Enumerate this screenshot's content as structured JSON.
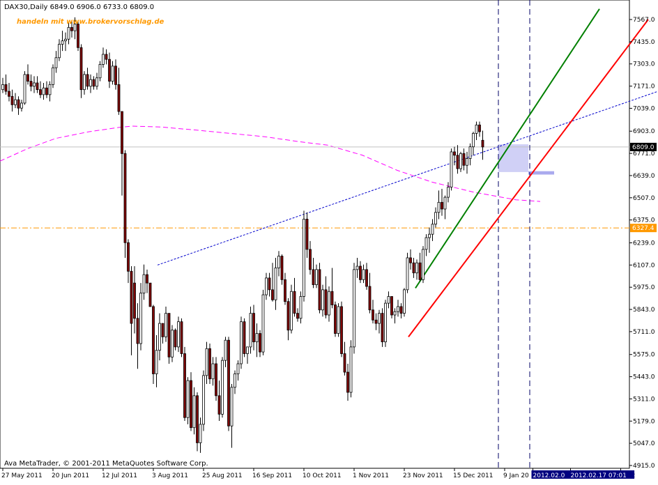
{
  "header": {
    "symbol_info": "DAX30,Daily  6849.0 6906.0 6733.0 6809.0",
    "watermark": "handeln mit www.brokervorschlag.de"
  },
  "footer": {
    "copyright": "Ava MetaTrader, © 2001-2011 MetaQuotes Software Corp."
  },
  "colors": {
    "background": "#ffffff",
    "frame": "#000000",
    "bull_candle": "#ffffff",
    "bear_candle": "#800000",
    "moving_average": "#ff00ff",
    "trendline_dashed": "#0000cc",
    "upper_channel": "#008000",
    "lower_channel": "#ff0000",
    "horizontal_level": "#ff9900",
    "watermark": "#ff9900",
    "highlight_zone": "#aaaaee",
    "current_price_label": "#000000"
  },
  "chart_data": {
    "type": "candlestick",
    "title": "DAX30,Daily",
    "last_bar": {
      "open": 6849.0,
      "high": 6906.0,
      "low": 6733.0,
      "close": 6809.0
    },
    "ylim": [
      4915,
      7630
    ],
    "y_ticks": [
      "7567.0",
      "7435.0",
      "7303.0",
      "7171.0",
      "7039.0",
      "6903.0",
      "6771.0",
      "6639.0",
      "6507.0",
      "6375.0",
      "6239.0",
      "6107.0",
      "5975.0",
      "5843.0",
      "5711.0",
      "5575.0",
      "5443.0",
      "5311.0",
      "5179.0",
      "5047.0",
      "4915.0"
    ],
    "y_tick_values": [
      7567,
      7435,
      7303,
      7171,
      7039,
      6903,
      6771,
      6639,
      6507,
      6375,
      6239,
      6107,
      5975,
      5843,
      5711,
      5575,
      5443,
      5311,
      5179,
      5047,
      4915
    ],
    "x_ticks": [
      "27 May 2011",
      "20 Jun 2011",
      "12 Jul 2011",
      "3 Aug 2011",
      "25 Aug 2011",
      "16 Sep 2011",
      "10 Oct 2011",
      "1 Nov 2011",
      "23 Nov 2011",
      "15 Dec 2011",
      "9 Jan 20",
      "2012",
      "2012.02.0",
      "2012.02.17 07:01"
    ],
    "x_tick_bars": [
      0,
      16,
      32,
      48,
      64,
      80,
      96,
      112,
      128,
      144,
      160,
      197,
      169,
      181
    ],
    "x_tick_highlighted": [
      false,
      false,
      false,
      false,
      false,
      false,
      false,
      false,
      false,
      false,
      false,
      false,
      true,
      true
    ],
    "current_price_label": "6809.0",
    "level_label": "6327.4",
    "horizontal_level": 6327.4,
    "price_marker": 6809.0,
    "bars": [
      [
        7150,
        7220,
        7130,
        7180
      ],
      [
        7180,
        7240,
        7120,
        7140
      ],
      [
        7140,
        7190,
        7080,
        7110
      ],
      [
        7110,
        7150,
        7020,
        7060
      ],
      [
        7060,
        7130,
        7040,
        7090
      ],
      [
        7090,
        7110,
        7000,
        7040
      ],
      [
        7040,
        7090,
        7020,
        7070
      ],
      [
        7070,
        7260,
        7060,
        7240
      ],
      [
        7240,
        7300,
        7180,
        7200
      ],
      [
        7200,
        7240,
        7140,
        7170
      ],
      [
        7170,
        7230,
        7130,
        7190
      ],
      [
        7190,
        7230,
        7130,
        7150
      ],
      [
        7150,
        7200,
        7100,
        7120
      ],
      [
        7120,
        7190,
        7090,
        7160
      ],
      [
        7160,
        7200,
        7100,
        7120
      ],
      [
        7120,
        7200,
        7080,
        7180
      ],
      [
        7180,
        7300,
        7160,
        7280
      ],
      [
        7280,
        7380,
        7250,
        7340
      ],
      [
        7340,
        7450,
        7320,
        7420
      ],
      [
        7420,
        7500,
        7380,
        7440
      ],
      [
        7440,
        7490,
        7380,
        7450
      ],
      [
        7450,
        7550,
        7420,
        7520
      ],
      [
        7520,
        7560,
        7460,
        7500
      ],
      [
        7500,
        7580,
        7450,
        7540
      ],
      [
        7540,
        7560,
        7380,
        7400
      ],
      [
        7400,
        7420,
        7100,
        7150
      ],
      [
        7150,
        7260,
        7120,
        7240
      ],
      [
        7240,
        7280,
        7150,
        7170
      ],
      [
        7170,
        7240,
        7130,
        7210
      ],
      [
        7210,
        7230,
        7150,
        7170
      ],
      [
        7170,
        7250,
        7150,
        7220
      ],
      [
        7220,
        7320,
        7200,
        7300
      ],
      [
        7300,
        7400,
        7280,
        7360
      ],
      [
        7360,
        7390,
        7300,
        7330
      ],
      [
        7330,
        7370,
        7160,
        7200
      ],
      [
        7200,
        7320,
        7180,
        7290
      ],
      [
        7290,
        7330,
        7150,
        7180
      ],
      [
        7180,
        7280,
        7000,
        7020
      ],
      [
        7020,
        6880,
        6520,
        6770
      ],
      [
        6770,
        6790,
        6150,
        6240
      ],
      [
        6240,
        6260,
        6000,
        6070
      ],
      [
        6070,
        6100,
        5570,
        5760
      ],
      [
        6000,
        6100,
        5700,
        5790
      ],
      [
        5790,
        5880,
        5490,
        5640
      ],
      [
        5640,
        6000,
        5600,
        5940
      ],
      [
        5940,
        6110,
        5900,
        6050
      ],
      [
        6050,
        6080,
        5940,
        6000
      ],
      [
        6000,
        6000,
        5880,
        5860
      ],
      [
        5860,
        5870,
        5400,
        5460
      ],
      [
        5460,
        5690,
        5380,
        5600
      ],
      [
        5600,
        5820,
        5540,
        5760
      ],
      [
        5760,
        5760,
        5640,
        5680
      ],
      [
        5680,
        5860,
        5650,
        5820
      ],
      [
        5820,
        5820,
        5520,
        5560
      ],
      [
        5560,
        5750,
        5530,
        5720
      ],
      [
        5720,
        5730,
        5600,
        5620
      ],
      [
        5620,
        5800,
        5590,
        5770
      ],
      [
        5770,
        5790,
        5560,
        5580
      ],
      [
        5580,
        5620,
        5180,
        5200
      ],
      [
        5200,
        5440,
        5160,
        5420
      ],
      [
        5420,
        5470,
        5120,
        5140
      ],
      [
        5140,
        5380,
        5100,
        5330
      ],
      [
        5330,
        5350,
        5000,
        5050
      ],
      [
        5050,
        5200,
        4990,
        5160
      ],
      [
        5160,
        5480,
        5120,
        5450
      ],
      [
        5450,
        5650,
        5400,
        5610
      ],
      [
        5610,
        5640,
        5400,
        5430
      ],
      [
        5430,
        5560,
        5390,
        5520
      ],
      [
        5520,
        5560,
        5300,
        5330
      ],
      [
        5330,
        5420,
        5180,
        5220
      ],
      [
        5220,
        5560,
        5200,
        5540
      ],
      [
        5540,
        5680,
        5500,
        5660
      ],
      [
        5660,
        5680,
        5120,
        5150
      ],
      [
        5150,
        5400,
        5020,
        5380
      ],
      [
        5380,
        5480,
        5340,
        5460
      ],
      [
        5460,
        5540,
        5420,
        5520
      ],
      [
        5520,
        5800,
        5490,
        5770
      ],
      [
        5770,
        5790,
        5560,
        5580
      ],
      [
        5580,
        5610,
        5520,
        5620
      ],
      [
        5620,
        5860,
        5580,
        5820
      ],
      [
        5820,
        5870,
        5600,
        5650
      ],
      [
        5650,
        5760,
        5560,
        5700
      ],
      [
        5700,
        5720,
        5560,
        5590
      ],
      [
        5590,
        5960,
        5570,
        5930
      ],
      [
        5930,
        6060,
        5900,
        6030
      ],
      [
        6030,
        6060,
        5920,
        5960
      ],
      [
        5960,
        6120,
        5890,
        5900
      ],
      [
        5900,
        6150,
        5840,
        6090
      ],
      [
        6090,
        6190,
        6040,
        6160
      ],
      [
        6160,
        6170,
        5990,
        6020
      ],
      [
        6020,
        6060,
        5870,
        5890
      ],
      [
        5890,
        5910,
        5660,
        5720
      ],
      [
        5720,
        5990,
        5700,
        5950
      ],
      [
        5950,
        6030,
        5800,
        5820
      ],
      [
        5820,
        5850,
        5770,
        5790
      ],
      [
        5790,
        5950,
        5760,
        5920
      ],
      [
        5920,
        6430,
        5890,
        6380
      ],
      [
        6380,
        6420,
        6150,
        6200
      ],
      [
        6200,
        6250,
        6050,
        6080
      ],
      [
        6080,
        6150,
        5970,
        5990
      ],
      [
        5990,
        6110,
        5970,
        6080
      ],
      [
        6080,
        6120,
        5820,
        5840
      ],
      [
        5840,
        5990,
        5800,
        5960
      ],
      [
        5960,
        6040,
        5790,
        5810
      ],
      [
        5810,
        5980,
        5770,
        5950
      ],
      [
        5950,
        6090,
        5850,
        5870
      ],
      [
        5870,
        5890,
        5680,
        5700
      ],
      [
        5700,
        5880,
        5680,
        5860
      ],
      [
        5860,
        5890,
        5560,
        5580
      ],
      [
        5580,
        5650,
        5450,
        5470
      ],
      [
        5470,
        5520,
        5300,
        5350
      ],
      [
        5350,
        5660,
        5320,
        5620
      ],
      [
        5620,
        6120,
        5580,
        6080
      ],
      [
        6080,
        6150,
        6030,
        6100
      ],
      [
        6100,
        6130,
        6000,
        6020
      ],
      [
        6020,
        6110,
        6000,
        6080
      ],
      [
        6080,
        6120,
        5960,
        5980
      ],
      [
        5980,
        6060,
        5820,
        5840
      ],
      [
        5840,
        5900,
        5760,
        5780
      ],
      [
        5780,
        5820,
        5720,
        5760
      ],
      [
        5760,
        5840,
        5700,
        5820
      ],
      [
        5820,
        5850,
        5620,
        5650
      ],
      [
        5650,
        5900,
        5620,
        5880
      ],
      [
        5880,
        5950,
        5850,
        5920
      ],
      [
        5920,
        5920,
        5790,
        5810
      ],
      [
        5810,
        5850,
        5760,
        5830
      ],
      [
        5830,
        5900,
        5800,
        5860
      ],
      [
        5860,
        5880,
        5790,
        5820
      ],
      [
        5820,
        5970,
        5800,
        5960
      ],
      [
        5960,
        6180,
        5940,
        6150
      ],
      [
        6150,
        6200,
        6080,
        6120
      ],
      [
        6120,
        6150,
        6030,
        6060
      ],
      [
        6060,
        6140,
        6020,
        6120
      ],
      [
        6120,
        6180,
        6010,
        6020
      ],
      [
        6020,
        6220,
        6000,
        6200
      ],
      [
        6200,
        6290,
        6160,
        6270
      ],
      [
        6270,
        6330,
        6180,
        6290
      ],
      [
        6290,
        6380,
        6250,
        6350
      ],
      [
        6350,
        6450,
        6330,
        6420
      ],
      [
        6420,
        6550,
        6380,
        6480
      ],
      [
        6480,
        6560,
        6400,
        6440
      ],
      [
        6440,
        6520,
        6380,
        6510
      ],
      [
        6510,
        6600,
        6480,
        6570
      ],
      [
        6570,
        6800,
        6550,
        6780
      ],
      [
        6780,
        6810,
        6700,
        6760
      ],
      [
        6760,
        6820,
        6650,
        6680
      ],
      [
        6680,
        6780,
        6660,
        6770
      ],
      [
        6770,
        6800,
        6670,
        6700
      ],
      [
        6700,
        6780,
        6650,
        6740
      ],
      [
        6740,
        6830,
        6700,
        6810
      ],
      [
        6810,
        6900,
        6760,
        6890
      ],
      [
        6890,
        6960,
        6850,
        6940
      ],
      [
        6940,
        6960,
        6870,
        6900
      ],
      [
        6849,
        6906,
        6733,
        6809
      ]
    ],
    "moving_average": [
      [
        0,
        6725
      ],
      [
        40,
        6800
      ],
      [
        80,
        6860
      ],
      [
        128,
        6900
      ],
      [
        170,
        6925
      ],
      [
        190,
        6933
      ],
      [
        230,
        6928
      ],
      [
        280,
        6910
      ],
      [
        330,
        6890
      ],
      [
        380,
        6870
      ],
      [
        430,
        6840
      ],
      [
        470,
        6820
      ],
      [
        520,
        6760
      ],
      [
        570,
        6670
      ],
      [
        620,
        6600
      ],
      [
        680,
        6540
      ],
      [
        740,
        6495
      ],
      [
        775,
        6485
      ]
    ],
    "highlight_zone": {
      "x_from": 715,
      "x_to": 758,
      "price_from": 6660,
      "price_to": 6825
    },
    "highlight_marker": {
      "x_from": 758,
      "x_to": 795,
      "price_from": 6645,
      "price_to": 6665
    },
    "vertical_lines_x": [
      715,
      760
    ],
    "trendlines": [
      {
        "role": "dashed",
        "points": [
          [
            226,
            6107
          ],
          [
            944,
            7140
          ]
        ]
      },
      {
        "role": "upper",
        "points": [
          [
            596,
            5970
          ],
          [
            860,
            7630
          ]
        ]
      },
      {
        "role": "lower",
        "points": [
          [
            586,
            5680
          ],
          [
            930,
            7567
          ]
        ]
      }
    ]
  }
}
